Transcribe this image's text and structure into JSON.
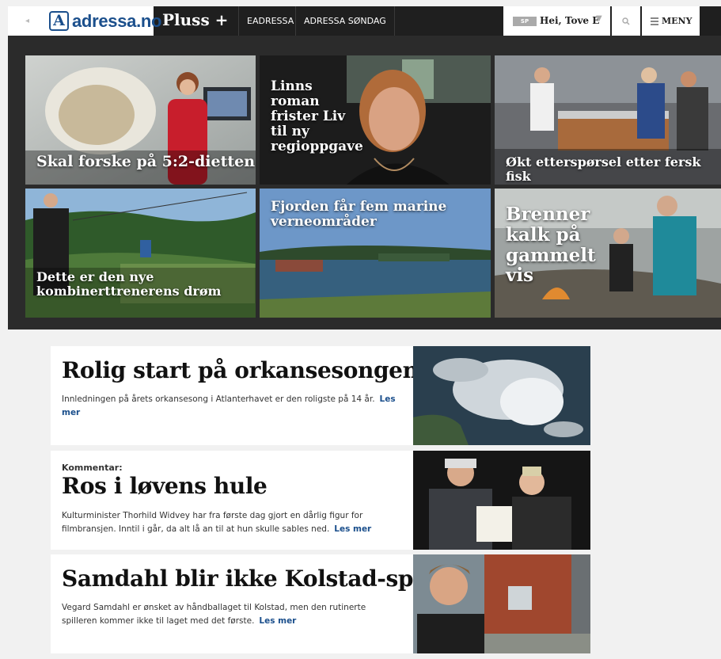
{
  "nav": {
    "logo_text": "adressa.no",
    "logo_badge": "A",
    "pluss": "Pluss +",
    "links": [
      "EADRESSA",
      "ADRESSA SØNDAG"
    ],
    "user_badge": "SP",
    "user_greeting": "Hei, Tove E",
    "menu_label": "MENY"
  },
  "hero": [
    {
      "title": "Skal forske på 5:2-dietten"
    },
    {
      "title": "Linns roman frister Liv til ny regioppgave"
    },
    {
      "title": "Økt etterspørsel etter fersk fisk"
    },
    {
      "title": "Dette er den nye kombinerttrenerens drøm"
    },
    {
      "title": "Fjorden får fem marine verneområder"
    },
    {
      "title": "Brenner kalk på gammelt vis"
    }
  ],
  "articles": [
    {
      "kicker": "",
      "headline": "Rolig start på orkansesongen",
      "teaser": "Innledningen på årets orkansesong i Atlanterhavet er den roligste på 14 år.",
      "read_more": "Les mer"
    },
    {
      "kicker": "Kommentar:",
      "headline": "Ros i løvens hule",
      "teaser": "Kulturminister Thorhild Widvey har fra første dag gjort en dårlig figur for filmbransjen. Inntil i går, da alt lå an til at hun skulle sables ned.",
      "read_more": "Les mer"
    },
    {
      "kicker": "",
      "headline": "Samdahl blir ikke Kolstad-spiller",
      "teaser": "Vegard Samdahl er ønsket av håndballaget til Kolstad, men den rutinerte spilleren kommer ikke til laget med det første.",
      "read_more": "Les mer"
    }
  ]
}
